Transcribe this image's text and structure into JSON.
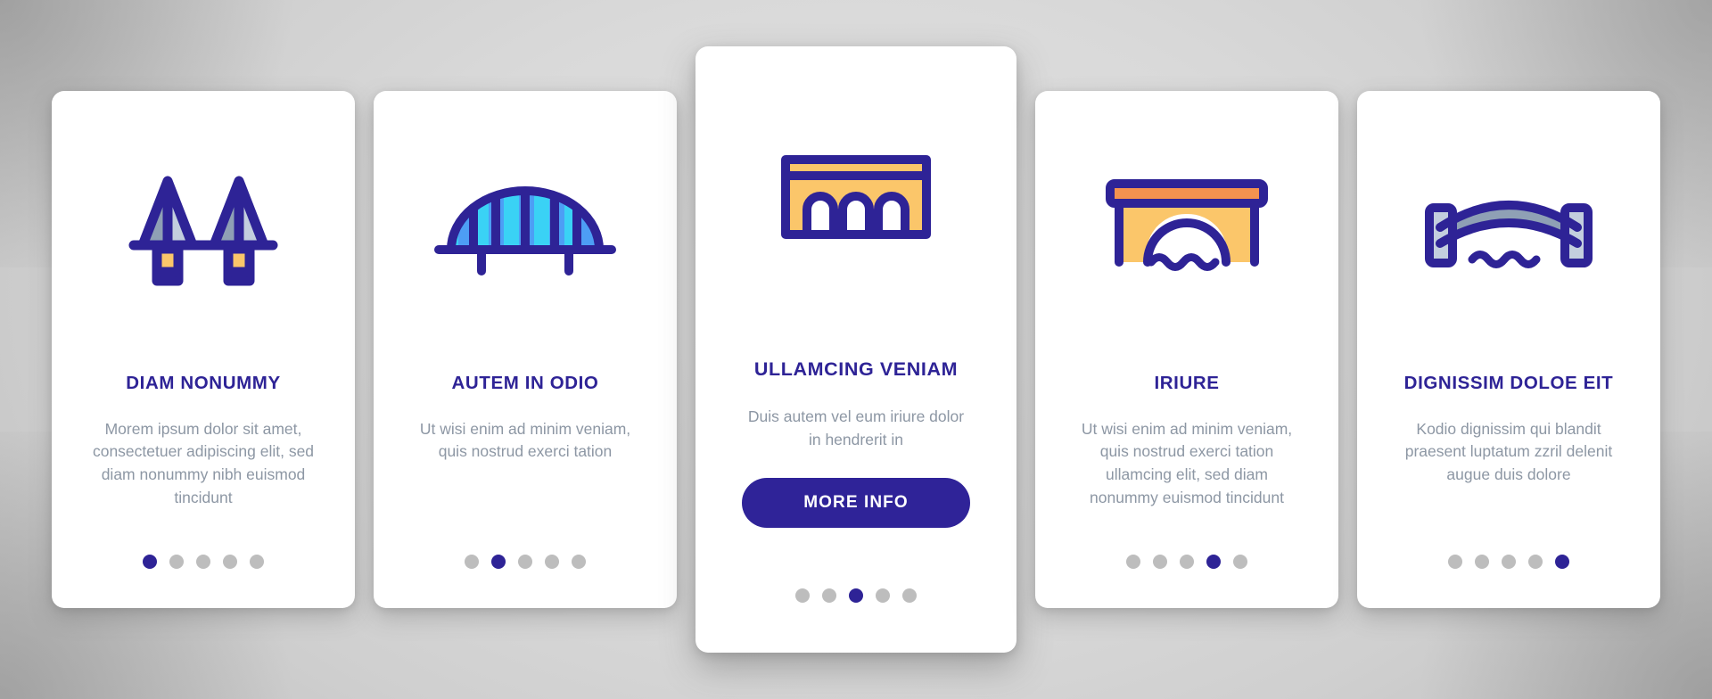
{
  "theme": {
    "accent": "#2e2396",
    "muted_text": "#8d97a4",
    "card_bg": "#ffffff",
    "page_bg": "#cfcfcf",
    "dot_inactive": "#bdbdbd",
    "icon_yellow": "#fbc66a",
    "icon_orange": "#f3924f",
    "icon_salmon": "#f7866a",
    "icon_cyan": "#3ad2f5",
    "icon_blue": "#4d9ef5",
    "icon_slate_light": "#c3cede",
    "icon_slate_dark": "#8fa0b5"
  },
  "cards": [
    {
      "id": "card-1",
      "icon": "cable-stayed-bridge-icon",
      "title": "DIAM NONUMMY",
      "body": "Morem ipsum dolor sit amet, consectetuer adipiscing elit, sed diam nonummy nibh euismod tincidunt",
      "dots": {
        "count": 5,
        "active_index": 0
      },
      "featured": false
    },
    {
      "id": "card-2",
      "icon": "striped-arch-bridge-icon",
      "title": "AUTEM IN ODIO",
      "body": "Ut wisi enim ad minim veniam, quis nostrud exerci tation",
      "dots": {
        "count": 5,
        "active_index": 1
      },
      "featured": false
    },
    {
      "id": "card-3",
      "icon": "arched-viaduct-bridge-icon",
      "title": "ULLAMCING VENIAM",
      "body": "Duis autem vel eum iriure dolor in hendrerit in",
      "button_label": "MORE INFO",
      "dots": {
        "count": 5,
        "active_index": 2
      },
      "featured": true
    },
    {
      "id": "card-4",
      "icon": "stone-arch-bridge-over-water-icon",
      "title": "IRIURE",
      "body": "Ut wisi enim ad minim veniam, quis nostrud exerci tation ullamcing elit, sed diam nonummy euismod tincidunt",
      "dots": {
        "count": 5,
        "active_index": 3
      },
      "featured": false
    },
    {
      "id": "card-5",
      "icon": "steel-arch-bridge-over-water-icon",
      "title": "DIGNISSIM DOLOE EIT",
      "body": "Kodio dignissim qui blandit praesent luptatum zzril delenit augue duis dolore",
      "dots": {
        "count": 5,
        "active_index": 4
      },
      "featured": false
    }
  ]
}
